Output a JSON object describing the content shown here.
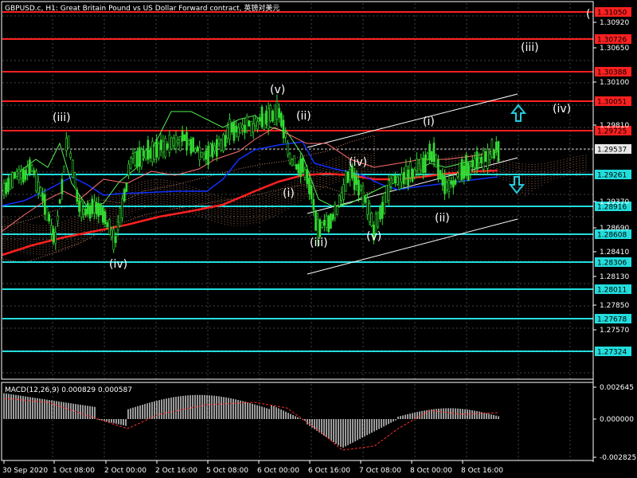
{
  "header": {
    "title": "GBPUSD.c, H1:  Great Britain Pound vs US Dollar Forward contract, 英镑对美元",
    "corner_label": "("
  },
  "macd": {
    "label": "MACD(12,26,9) 0.000829 0.000587",
    "ticks": [
      "0.002645",
      "0.000000",
      "-0.002825"
    ]
  },
  "price_axis": {
    "ticks": [
      "1.30920",
      "1.30650",
      "1.30100",
      "1.29810",
      "1.29370",
      "1.28690",
      "1.28410",
      "1.28130",
      "1.27850",
      "1.27570"
    ]
  },
  "levels": {
    "red": [
      {
        "value": "1.31050"
      },
      {
        "value": "1.30726"
      },
      {
        "value": "1.30388"
      },
      {
        "value": "1.30051"
      },
      {
        "value": "1.29725"
      }
    ],
    "current": {
      "value": "1.29537"
    },
    "cyan": [
      {
        "value": "1.29261"
      },
      {
        "value": "1.28916"
      },
      {
        "value": "1.28608"
      },
      {
        "value": "1.28306"
      },
      {
        "value": "1.28011"
      },
      {
        "value": "1.27678"
      },
      {
        "value": "1.27324"
      }
    ]
  },
  "time_axis": {
    "ticks": [
      "30 Sep 2020",
      "1 Oct 08:00",
      "2 Oct 00:00",
      "2 Oct 16:00",
      "5 Oct 08:00",
      "6 Oct 00:00",
      "6 Oct 16:00",
      "7 Oct 08:00",
      "8 Oct 00:00",
      "8 Oct 16:00"
    ]
  },
  "waves": [
    "(iii)",
    "(iv)",
    "(v)",
    "(ii)",
    "(i)",
    "(iii)",
    "(iv)",
    "(v)",
    "(i)",
    "(ii)",
    "(iii)",
    "(iv)"
  ],
  "colors": {
    "background": "#000000",
    "candles": "#33dd33",
    "red_levels": "#ff2020",
    "cyan_levels": "#22dddd",
    "grid": "#444444",
    "ma_red": "#ff2020",
    "ma_blue": "#1030ff",
    "cloud": "#c08060"
  },
  "icons": [
    "arrow-up-icon",
    "arrow-down-icon"
  ],
  "chart_data": {
    "type": "candlestick",
    "ylim": [
      1.27,
      1.312
    ],
    "price_levels_red": [
      1.3105,
      1.30726,
      1.30388,
      1.30051,
      1.29725
    ],
    "price_levels_cyan": [
      1.29261,
      1.28916,
      1.28608,
      1.28306,
      1.28011,
      1.27678,
      1.27324
    ],
    "current_price": 1.29537,
    "x": [
      "30 Sep 2020",
      "1 Oct 08:00",
      "2 Oct 00:00",
      "2 Oct 16:00",
      "5 Oct 08:00",
      "6 Oct 00:00",
      "6 Oct 16:00",
      "7 Oct 08:00",
      "8 Oct 00:00",
      "8 Oct 16:00"
    ],
    "close": [
      1.2865,
      1.289,
      1.293,
      1.292,
      1.295,
      1.299,
      1.288,
      1.2865,
      1.2955,
      1.2954
    ],
    "macd": {
      "value": 0.000829,
      "signal": 0.000587,
      "ylim": [
        -0.002825,
        0.002645
      ]
    }
  }
}
